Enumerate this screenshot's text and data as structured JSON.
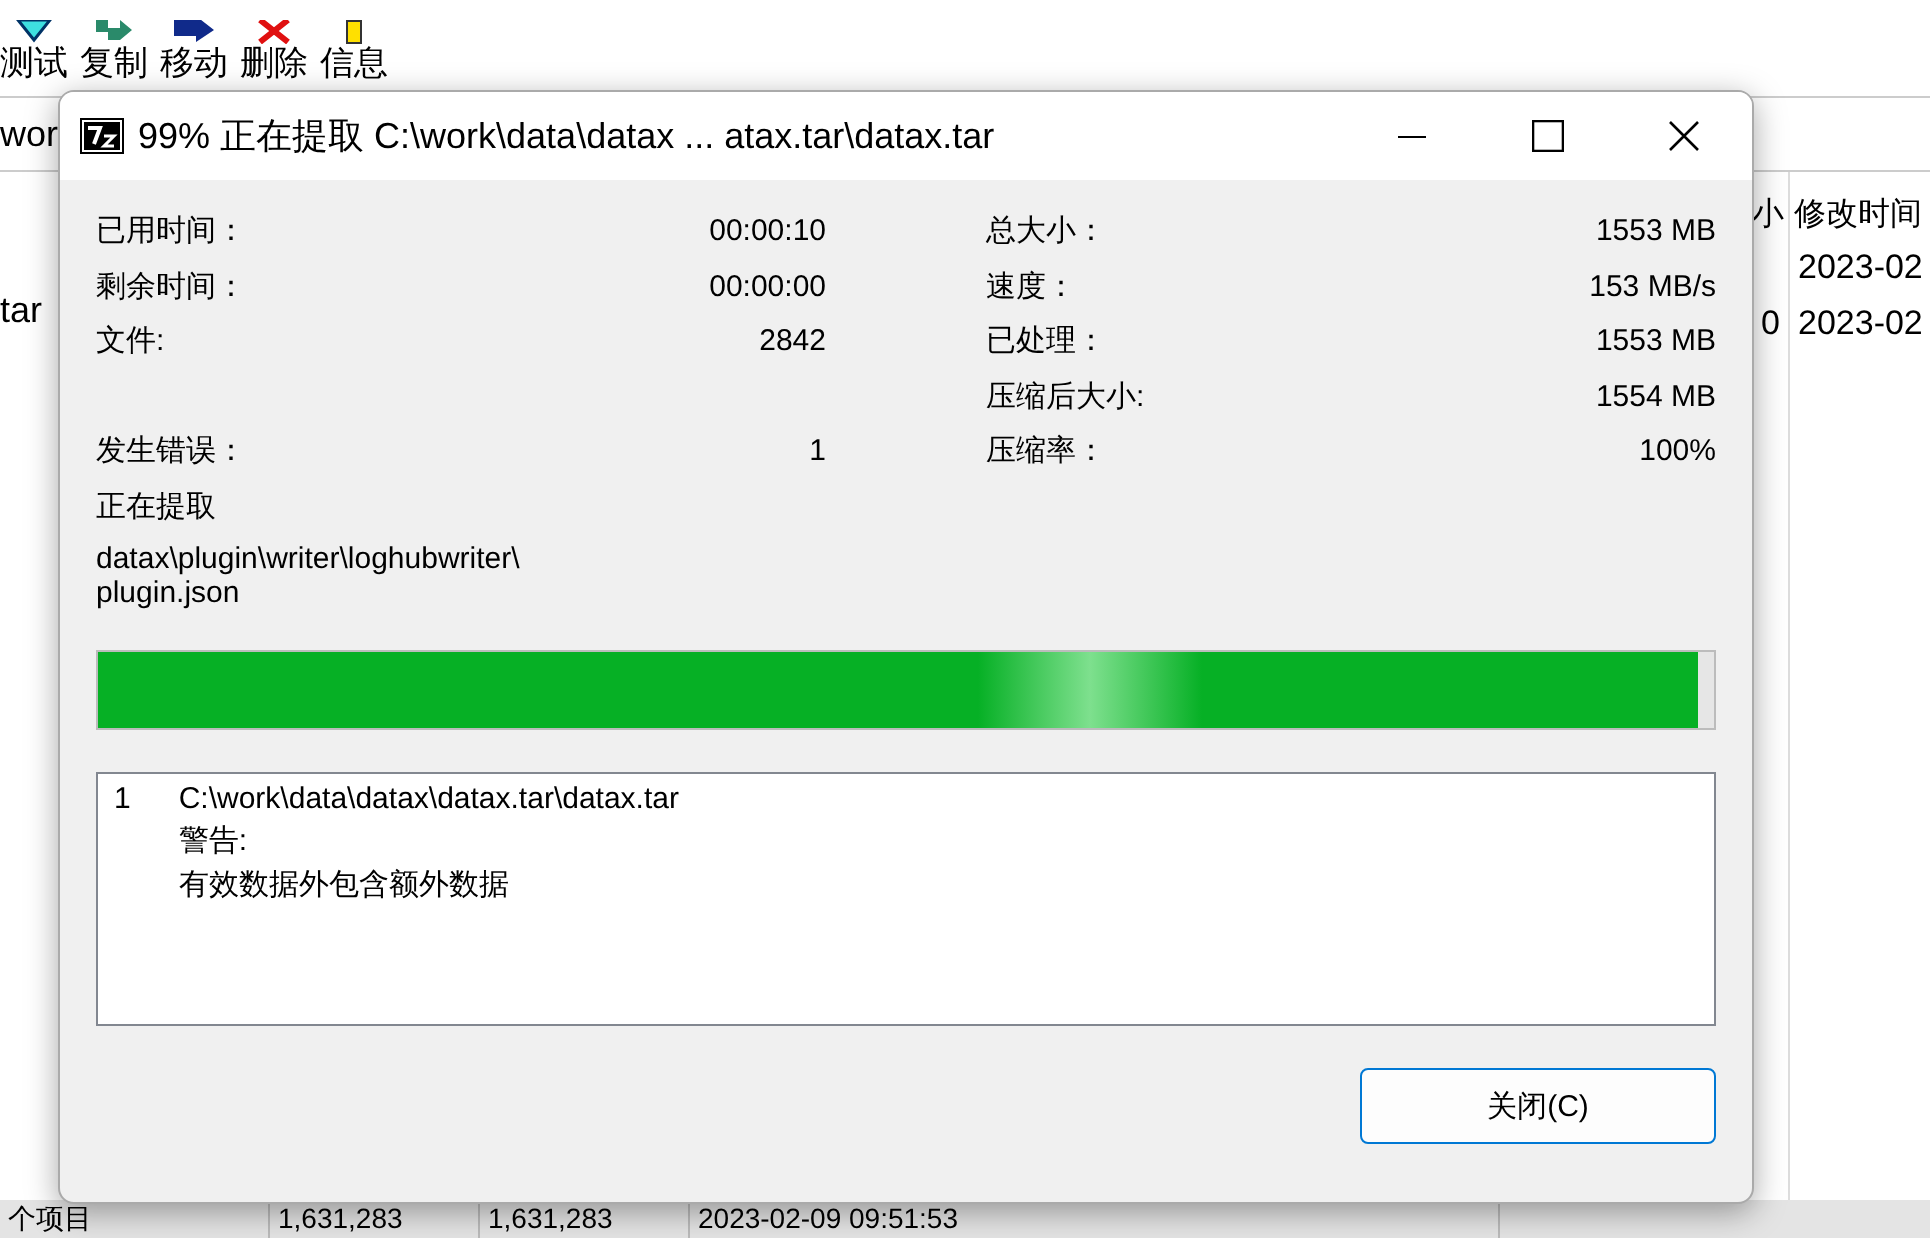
{
  "toolbar": {
    "items": [
      {
        "kind": "test",
        "label": "测试"
      },
      {
        "kind": "copy",
        "label": "复制"
      },
      {
        "kind": "move",
        "label": "移动"
      },
      {
        "kind": "delete",
        "label": "删除"
      },
      {
        "kind": "info",
        "label": "信息"
      }
    ]
  },
  "address_bar": {
    "value": "wor"
  },
  "file_list": {
    "columns": [
      "小",
      "修改时间"
    ],
    "rows": [
      {
        "name": "",
        "size": "",
        "modified": "2023-02"
      },
      {
        "name": "tar",
        "size": "0",
        "modified": "2023-02"
      }
    ]
  },
  "status_bar": [
    "个项目",
    "1,631,283",
    "1,631,283",
    "2023-02-09 09:51:53"
  ],
  "dialog": {
    "title": "99% 正在提取 C:\\work\\data\\datax ... atax.tar\\datax.tar",
    "left_stats": [
      {
        "label": "已用时间：",
        "value": "00:00:10"
      },
      {
        "label": "剩余时间：",
        "value": "00:00:00"
      },
      {
        "label": "文件:",
        "value": "2842"
      },
      {
        "label": "发生错误：",
        "value": "1",
        "gap_before": true
      }
    ],
    "right_stats": [
      {
        "label": "总大小：",
        "value": "1553 MB"
      },
      {
        "label": "速度：",
        "value": "153 MB/s"
      },
      {
        "label": "已处理：",
        "value": "1553 MB"
      },
      {
        "label": "压缩后大小:",
        "value": "1554 MB"
      },
      {
        "label": "压缩率：",
        "value": "100%"
      }
    ],
    "status": "正在提取",
    "current_file": [
      "datax\\plugin\\writer\\loghubwriter\\",
      "plugin.json"
    ],
    "progress": {
      "level": 0.99
    },
    "messages": [
      {
        "index": "1",
        "lines": [
          "C:\\work\\data\\datax\\datax.tar\\datax.tar",
          "警告:",
          "有效数据外包含额外数据"
        ]
      }
    ],
    "close_button": "关闭(C)"
  }
}
